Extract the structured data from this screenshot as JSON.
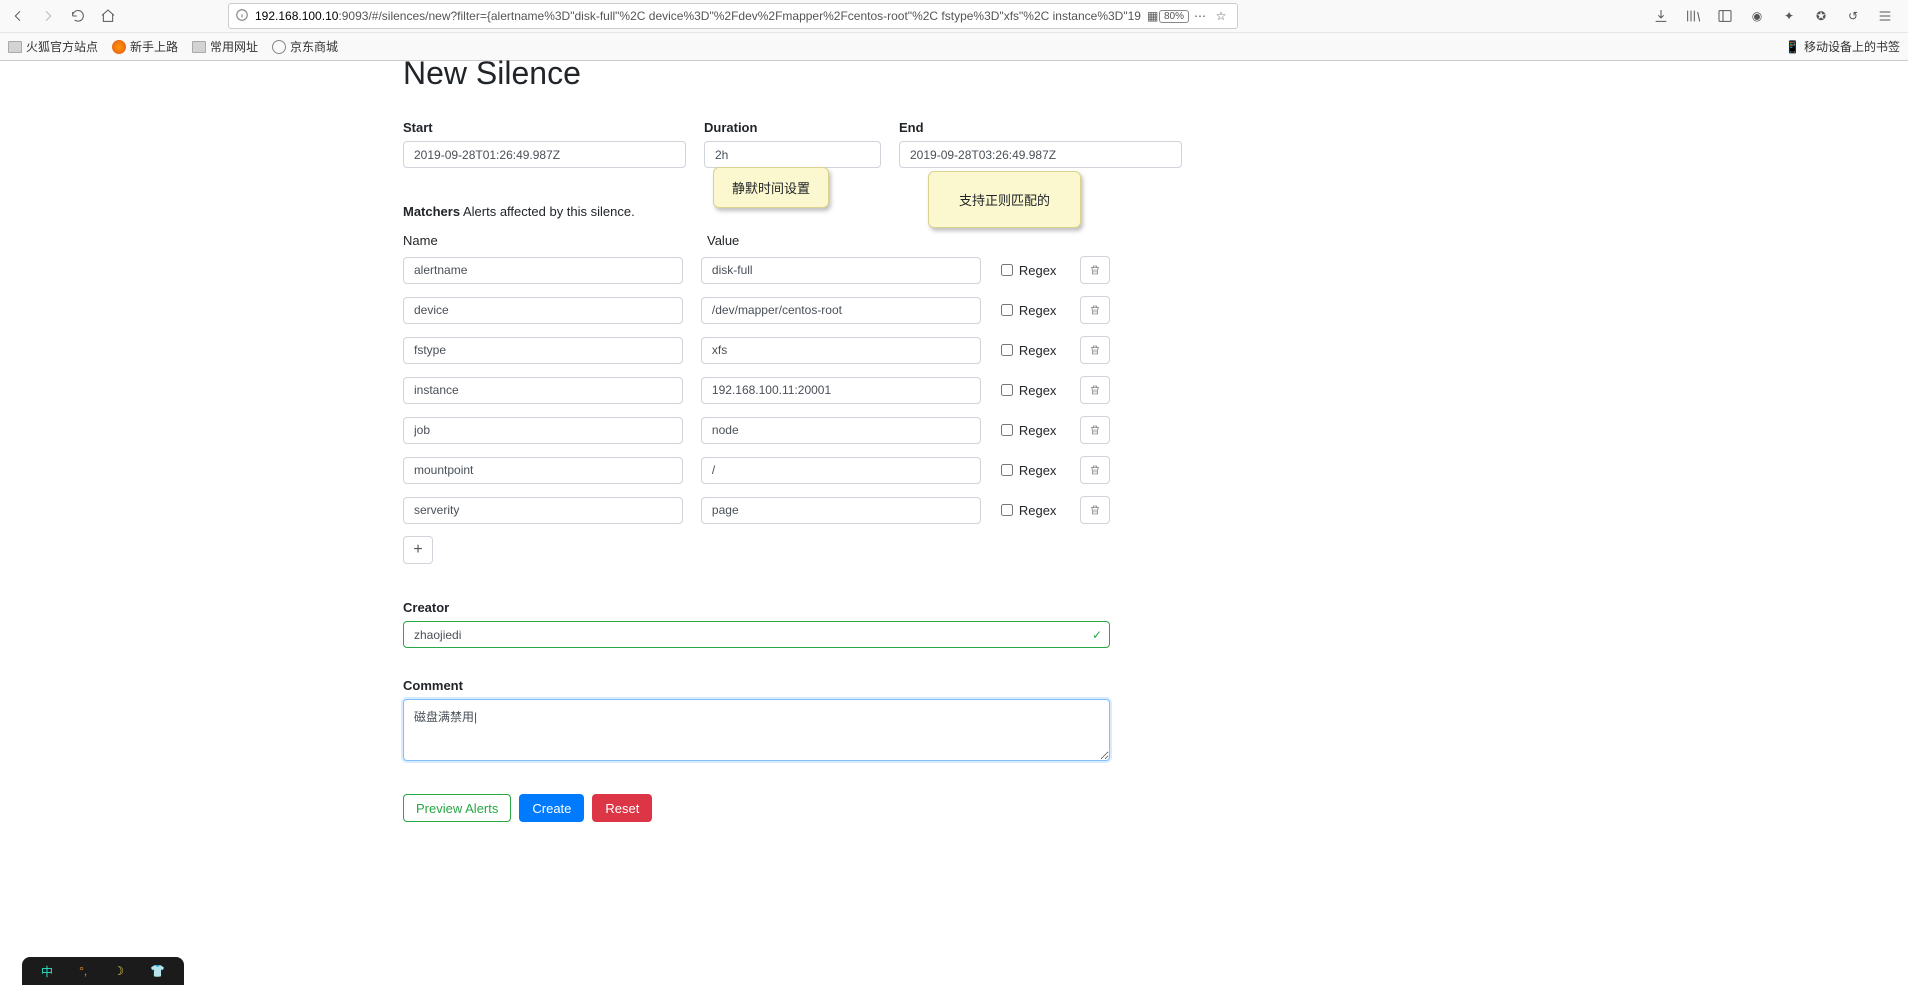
{
  "browser": {
    "url_host": "192.168.100.10",
    "url_path": ":9093/#/silences/new?filter={alertname%3D\"disk-full\"%2C device%3D\"%2Fdev%2Fmapper%2Fcentos-root\"%2C fstype%3D\"xfs\"%2C instance%3D\"19",
    "zoom": "80%",
    "bookmarks": {
      "b1": "火狐官方站点",
      "b2": "新手上路",
      "b3": "常用网址",
      "b4": "京东商城",
      "mobile": "移动设备上的书签"
    }
  },
  "page": {
    "title": "New Silence",
    "start_label": "Start",
    "duration_label": "Duration",
    "end_label": "End",
    "start_value": "2019-09-28T01:26:49.987Z",
    "duration_value": "2h",
    "end_value": "2019-09-28T03:26:49.987Z",
    "matchers_label": "Matchers",
    "matchers_hint": "Alerts affected by this silence.",
    "name_header": "Name",
    "value_header": "Value",
    "regex_label": "Regex",
    "matchers": [
      {
        "name": "alertname",
        "value": "disk-full"
      },
      {
        "name": "device",
        "value": "/dev/mapper/centos-root"
      },
      {
        "name": "fstype",
        "value": "xfs"
      },
      {
        "name": "instance",
        "value": "192.168.100.11:20001"
      },
      {
        "name": "job",
        "value": "node"
      },
      {
        "name": "mountpoint",
        "value": "/"
      },
      {
        "name": "serverity",
        "value": "page"
      }
    ],
    "creator_label": "Creator",
    "creator_value": "zhaojiedi",
    "comment_label": "Comment",
    "comment_value": "磁盘满禁用|",
    "preview_btn": "Preview Alerts",
    "create_btn": "Create",
    "reset_btn": "Reset",
    "note1": "静默时间设置",
    "note2": "支持正则匹配的"
  }
}
